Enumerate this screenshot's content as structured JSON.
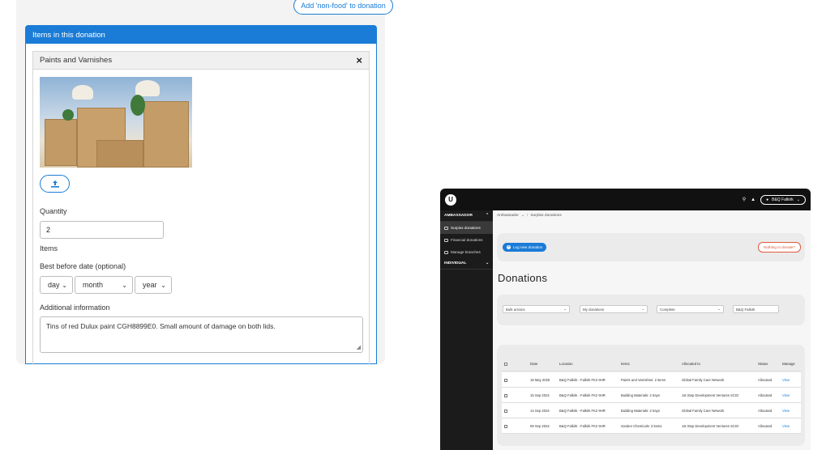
{
  "form": {
    "add_nonfood_label": "Add 'non-food' to donation",
    "items_header": "Items in this donation",
    "item": {
      "title": "Paints and Varnishes",
      "close_glyph": "×",
      "quantity_label": "Quantity",
      "quantity_value": "2",
      "unit_label": "Items",
      "best_before_label": "Best before date (optional)",
      "day_value": "day",
      "month_value": "month",
      "year_value": "year",
      "additional_info_label": "Additional information",
      "additional_info_value": "Tins of red Dulux paint CGH8899E0. Small amount of damage on both lids."
    }
  },
  "app": {
    "logo_glyph": "U",
    "user_name": "B&Q Falkirk",
    "sidebar": {
      "ambassador": "AMBASSADOR",
      "items": [
        {
          "label": "Surplus donations",
          "icon": "inbox-icon"
        },
        {
          "label": "Financial donations",
          "icon": "cash-icon"
        },
        {
          "label": "Manage branches",
          "icon": "branch-icon"
        }
      ],
      "individual": "INDIVIDUAL"
    },
    "breadcrumb": {
      "first": "Ambassador",
      "sep": "/",
      "second": "Surplus donations"
    },
    "log_new_donation": "Log new donation",
    "nothing_to_donate": "Nothing to donate?",
    "page_title": "Donations",
    "filters": {
      "bulk_actions": "Bulk actions",
      "my_donations": "My donations",
      "complete": "Complete",
      "branch": "B&Q Falkirk"
    },
    "table": {
      "headers": [
        "Date",
        "Location",
        "Items",
        "Allocated to",
        "Status",
        "Manage"
      ],
      "rows": [
        [
          "18 May 2025",
          "B&Q Falkirk - Falkirk FK2 9HR",
          "Paints and Varnishes: 2 items",
          "Global Family Care Network",
          "Allocated",
          "View"
        ],
        [
          "15 Sep 2024",
          "B&Q Falkirk - Falkirk FK2 9HR",
          "Building Materials: 2 trays",
          "1st Step Development Ventures SCIO",
          "Allocated",
          "View"
        ],
        [
          "14 Sep 2024",
          "B&Q Falkirk - Falkirk FK2 9HR",
          "Building Materials: 2 trays",
          "Global Family Care Network",
          "Allocated",
          "View"
        ],
        [
          "09 Sep 2024",
          "B&Q Falkirk - Falkirk FK2 9HR",
          "Garden Chemicals: 3 items",
          "1st Step Development Ventures SCIO",
          "Allocated",
          "View"
        ]
      ]
    }
  },
  "colors": {
    "primary": "#1a7cd6",
    "danger": "#e05a3a",
    "sidebar": "#1b1b1b"
  }
}
